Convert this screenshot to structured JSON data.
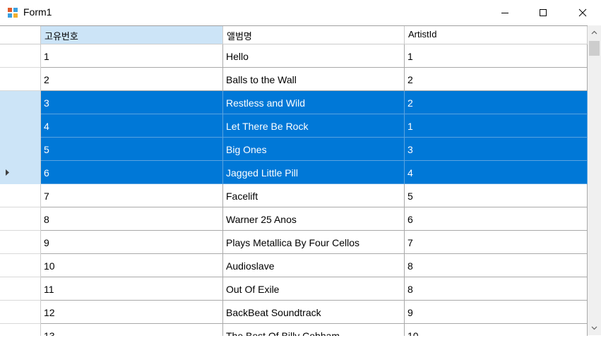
{
  "window": {
    "title": "Form1",
    "controls": {
      "minimize_icon": "minimize-icon",
      "maximize_icon": "maximize-icon",
      "close_icon": "close-icon"
    }
  },
  "grid": {
    "columns": [
      "고유번호",
      "앨범명",
      "ArtistId"
    ],
    "selected_header_index": 0,
    "current_row_index": 5,
    "rows": [
      {
        "id": "1",
        "album": "Hello",
        "artist": "1",
        "selected": false
      },
      {
        "id": "2",
        "album": "Balls to the Wall",
        "artist": "2",
        "selected": false
      },
      {
        "id": "3",
        "album": "Restless and Wild",
        "artist": "2",
        "selected": true
      },
      {
        "id": "4",
        "album": "Let There Be Rock",
        "artist": "1",
        "selected": true
      },
      {
        "id": "5",
        "album": "Big Ones",
        "artist": "3",
        "selected": true
      },
      {
        "id": "6",
        "album": "Jagged Little Pill",
        "artist": "4",
        "selected": true
      },
      {
        "id": "7",
        "album": "Facelift",
        "artist": "5",
        "selected": false
      },
      {
        "id": "8",
        "album": "Warner 25 Anos",
        "artist": "6",
        "selected": false
      },
      {
        "id": "9",
        "album": "Plays Metallica By Four Cellos",
        "artist": "7",
        "selected": false
      },
      {
        "id": "10",
        "album": "Audioslave",
        "artist": "8",
        "selected": false
      },
      {
        "id": "11",
        "album": "Out Of Exile",
        "artist": "8",
        "selected": false
      },
      {
        "id": "12",
        "album": "BackBeat Soundtrack",
        "artist": "9",
        "selected": false
      },
      {
        "id": "13",
        "album": "The Best Of Billy Cobham",
        "artist": "10",
        "selected": false
      }
    ]
  },
  "colors": {
    "selection": "#0078d7",
    "header_selected": "#cce4f7",
    "scrollbar_track": "#f0f0f0"
  }
}
